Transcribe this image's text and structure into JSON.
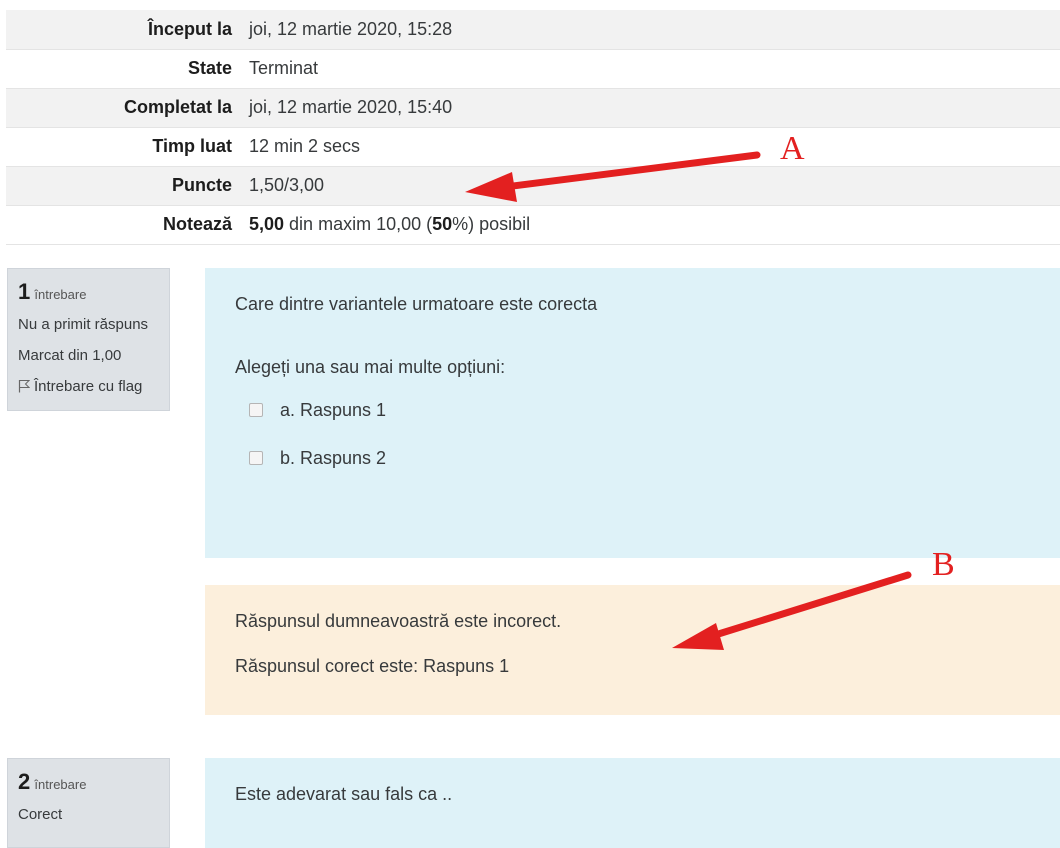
{
  "summary": {
    "rows": [
      {
        "label": "Început la",
        "value": "joi, 12 martie 2020, 15:28"
      },
      {
        "label": "State",
        "value": "Terminat"
      },
      {
        "label": "Completat la",
        "value": "joi, 12 martie 2020, 15:40"
      },
      {
        "label": "Timp luat",
        "value": "12 min 2 secs"
      },
      {
        "label": "Puncte",
        "value": "1,50/3,00"
      }
    ],
    "grade": {
      "label": "Notează",
      "score": "5,00",
      "middle": " din maxim 10,00 (",
      "percent": "50",
      "suffix": "%) posibil"
    }
  },
  "question1": {
    "number": "1",
    "word": "întrebare",
    "status": "Nu a primit răspuns",
    "marked": "Marcat din 1,00",
    "flag_label": "Întrebare cu flag",
    "text": "Care dintre variantele urmatoare este corecta",
    "prompt": "Alegeți una sau mai multe opțiuni:",
    "answers": [
      "a. Raspuns 1",
      "b. Raspuns 2"
    ],
    "feedback_incorrect": "Răspunsul dumneavoastră este incorect.",
    "feedback_correct": "Răspunsul corect este: Raspuns 1"
  },
  "question2": {
    "number": "2",
    "word": "întrebare",
    "status": "Corect",
    "text": "Este adevarat sau fals ca .."
  },
  "annotations": {
    "a": "A",
    "b": "B",
    "color": "#e32020"
  }
}
